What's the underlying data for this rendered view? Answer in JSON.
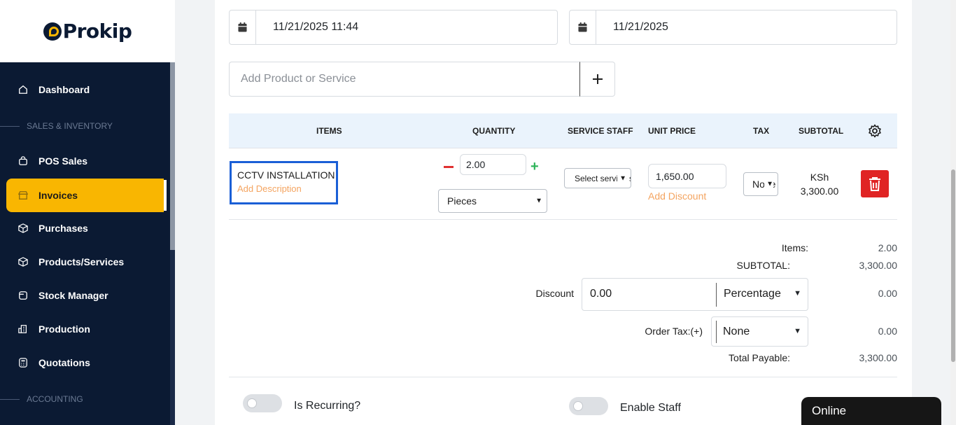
{
  "brand": {
    "name": "Prokip"
  },
  "sidebar": {
    "items": [
      {
        "label": "Dashboard",
        "icon": "home-icon"
      },
      {
        "section": "SALES & INVENTORY"
      },
      {
        "label": "POS Sales",
        "icon": "bag-icon"
      },
      {
        "label": "Invoices",
        "icon": "store-icon",
        "active": true
      },
      {
        "label": "Purchases",
        "icon": "box-icon"
      },
      {
        "label": "Products/Services",
        "icon": "cube-icon"
      },
      {
        "label": "Stock Manager",
        "icon": "stock-icon"
      },
      {
        "label": "Production",
        "icon": "building-icon"
      },
      {
        "label": "Quotations",
        "icon": "calculator-icon"
      },
      {
        "section": "ACCOUNTING"
      }
    ]
  },
  "form": {
    "invoice_datetime": "11/21/2025 11:44",
    "due_date": "11/21/2025",
    "product_placeholder": "Add Product or Service",
    "add_button": "+"
  },
  "table": {
    "headers": {
      "items": "ITEMS",
      "quantity": "QUANTITY",
      "service_staff": "SERVICE STAFF",
      "unit_price": "UNIT PRICE",
      "tax": "TAX",
      "subtotal": "SUBTOTAL"
    },
    "row": {
      "name": "CCTV INSTALLATION",
      "add_description": "Add Description",
      "quantity": "2.00",
      "unit": "Pieces",
      "staff_placeholder": "Select service staff",
      "unit_price": "1,650.00",
      "add_discount": "Add Discount",
      "tax": "None",
      "currency": "KSh",
      "subtotal": "3,300.00"
    }
  },
  "summary": {
    "items_label": "Items:",
    "items_value": "2.00",
    "subtotal_label": "SUBTOTAL:",
    "subtotal_value": "3,300.00",
    "discount_label": "Discount",
    "discount_amount": "0.00",
    "discount_type": "Percentage",
    "discount_value": "0.00",
    "order_tax_label": "Order Tax:(+)",
    "order_tax_type": "None",
    "order_tax_value": "0.00",
    "total_label": "Total Payable:",
    "total_value": "3,300.00"
  },
  "toggles": {
    "recurring": "Is Recurring?",
    "enable_staff": "Enable Staff"
  },
  "chat": {
    "status": "Online"
  },
  "colors": {
    "sidebar_bg": "#0b1a33",
    "accent": "#f9b601",
    "delete": "#e02424",
    "add_description": "#f4a460",
    "selection": "#1a5fd6"
  }
}
